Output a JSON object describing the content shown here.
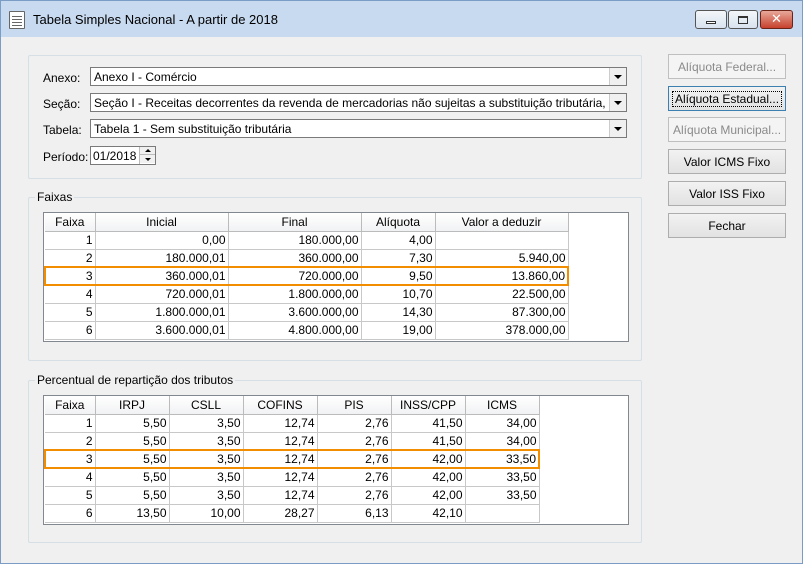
{
  "window": {
    "title": "Tabela Simples Nacional - A partir de 2018"
  },
  "form": {
    "anexo_label": "Anexo:",
    "anexo_value": "Anexo I - Comércio",
    "secao_label": "Seção:",
    "secao_value": "Seção I - Receitas decorrentes da revenda de mercadorias não sujeitas a substituição tributária, exceto as re",
    "tabela_label": "Tabela:",
    "tabela_value": "Tabela 1 - Sem substituição tributária",
    "periodo_label": "Período:",
    "periodo_value": "01/2018"
  },
  "faixas": {
    "legend": "Faixas",
    "columns": [
      "Faixa",
      "Inicial",
      "Final",
      "Alíquota",
      "Valor a deduzir"
    ],
    "rows": [
      [
        "1",
        "0,00",
        "180.000,00",
        "4,00",
        ""
      ],
      [
        "2",
        "180.000,01",
        "360.000,00",
        "7,30",
        "5.940,00"
      ],
      [
        "3",
        "360.000,01",
        "720.000,00",
        "9,50",
        "13.860,00"
      ],
      [
        "4",
        "720.000,01",
        "1.800.000,00",
        "10,70",
        "22.500,00"
      ],
      [
        "5",
        "1.800.000,01",
        "3.600.000,00",
        "14,30",
        "87.300,00"
      ],
      [
        "6",
        "3.600.000,01",
        "4.800.000,00",
        "19,00",
        "378.000,00"
      ]
    ],
    "selected_row": 2
  },
  "percentual": {
    "legend": "Percentual de repartição dos tributos",
    "columns": [
      "Faixa",
      "IRPJ",
      "CSLL",
      "COFINS",
      "PIS",
      "INSS/CPP",
      "ICMS"
    ],
    "rows": [
      [
        "1",
        "5,50",
        "3,50",
        "12,74",
        "2,76",
        "41,50",
        "34,00"
      ],
      [
        "2",
        "5,50",
        "3,50",
        "12,74",
        "2,76",
        "41,50",
        "34,00"
      ],
      [
        "3",
        "5,50",
        "3,50",
        "12,74",
        "2,76",
        "42,00",
        "33,50"
      ],
      [
        "4",
        "5,50",
        "3,50",
        "12,74",
        "2,76",
        "42,00",
        "33,50"
      ],
      [
        "5",
        "5,50",
        "3,50",
        "12,74",
        "2,76",
        "42,00",
        "33,50"
      ],
      [
        "6",
        "13,50",
        "10,00",
        "28,27",
        "6,13",
        "42,10",
        ""
      ]
    ],
    "selected_row": 2
  },
  "buttons": {
    "aliquota_federal": "Alíquota Federal...",
    "aliquota_estadual": "Alíquota Estadual...",
    "aliquota_municipal": "Alíquota Municipal...",
    "valor_icms_fixo": "Valor ICMS Fixo",
    "valor_iss_fixo": "Valor ISS Fixo",
    "fechar": "Fechar"
  }
}
